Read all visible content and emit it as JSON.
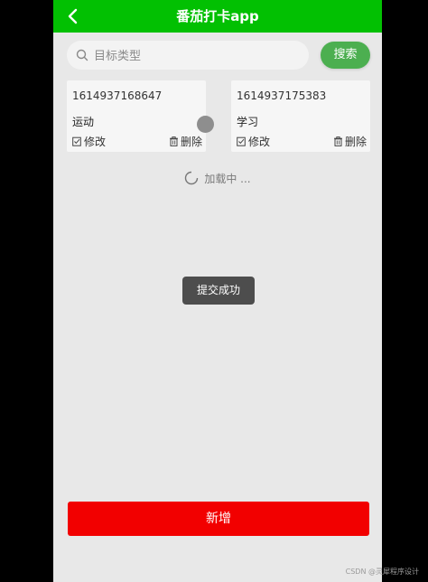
{
  "header": {
    "title": "番茄打卡app",
    "back_icon": "chevron-left-icon",
    "bg_color": "#02c002"
  },
  "search": {
    "placeholder": "目标类型",
    "value": "",
    "icon": "search-icon",
    "button_label": "搜索",
    "button_color": "#4caf50"
  },
  "cards": [
    {
      "id": "1614937168647",
      "type": "运动",
      "edit_label": "修改",
      "delete_label": "删除"
    },
    {
      "id": "1614937175383",
      "type": "学习",
      "edit_label": "修改",
      "delete_label": "删除"
    }
  ],
  "loading": {
    "text": "加载中 ...",
    "icon": "spinner-icon"
  },
  "toast": {
    "text": "提交成功"
  },
  "footer": {
    "add_label": "新增",
    "add_color": "#f20000"
  },
  "watermark": "CSDN @灵犀程序设计"
}
